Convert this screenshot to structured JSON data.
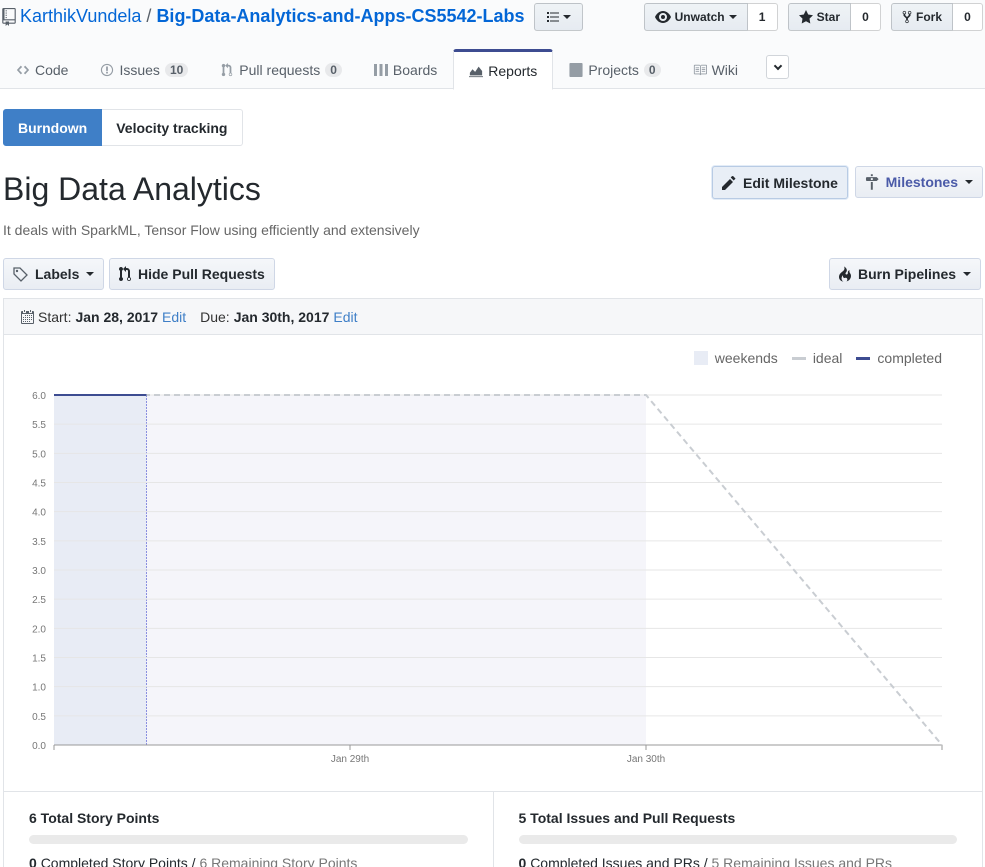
{
  "repo": {
    "owner": "KarthikVundela",
    "separator": "/",
    "name": "Big-Data-Analytics-and-Apps-CS5542-Labs"
  },
  "actions": {
    "watch_label": "Unwatch",
    "watch_count": "1",
    "star_label": "Star",
    "star_count": "0",
    "fork_label": "Fork",
    "fork_count": "0"
  },
  "nav": {
    "code": "Code",
    "issues": "Issues",
    "issues_count": "10",
    "pulls": "Pull requests",
    "pulls_count": "0",
    "boards": "Boards",
    "reports": "Reports",
    "projects": "Projects",
    "projects_count": "0",
    "wiki": "Wiki"
  },
  "subnav": {
    "burndown": "Burndown",
    "velocity": "Velocity tracking"
  },
  "milestone": {
    "title": "Big Data Analytics",
    "description": "It deals with SparkML, Tensor Flow using efficiently and extensively",
    "edit_label": "Edit Milestone",
    "milestones_label": "Milestones"
  },
  "toolbar": {
    "labels": "Labels",
    "hide_pr": "Hide Pull Requests",
    "burn_pipelines": "Burn Pipelines"
  },
  "dates": {
    "start_label": "Start:",
    "start_value": "Jan 28, 2017",
    "start_edit": "Edit",
    "due_label": "Due:",
    "due_value": "Jan 30th, 2017",
    "due_edit": "Edit"
  },
  "legend": {
    "weekends": "weekends",
    "ideal": "ideal",
    "completed": "completed"
  },
  "chart_data": {
    "type": "line",
    "ylim": [
      0,
      6
    ],
    "y_ticks": [
      "0.0",
      "0.5",
      "1.0",
      "1.5",
      "2.0",
      "2.5",
      "3.0",
      "3.5",
      "4.0",
      "4.5",
      "5.0",
      "5.5",
      "6.0"
    ],
    "x_domain": [
      "2017-01-28T00:00",
      "2017-01-31T00:00"
    ],
    "x_ticks": [
      {
        "label": "Jan 29th",
        "date": "2017-01-29T00:00"
      },
      {
        "label": "Jan 30th",
        "date": "2017-01-30T00:00"
      }
    ],
    "weekends": [
      {
        "start": "2017-01-28T00:00",
        "end": "2017-01-28T07:30"
      }
    ],
    "ideal": {
      "points": [
        [
          "2017-01-28T00:00",
          6
        ],
        [
          "2017-01-30T00:00",
          6
        ],
        [
          "2017-01-31T00:00",
          0
        ]
      ]
    },
    "series": [
      {
        "name": "completed",
        "points": [
          [
            "2017-01-28T00:00",
            6
          ],
          [
            "2017-01-28T07:30",
            6
          ]
        ]
      }
    ],
    "colors": {
      "completed": "#3d4c91",
      "ideal": "#c9cdd2",
      "weekend": "#e8ecf5",
      "period": "#f5f5fa"
    }
  },
  "stats": {
    "story_points_title": "6 Total Story Points",
    "story_completed_num": "0",
    "story_completed_label": "Completed Story Points",
    "story_remaining": "6 Remaining Story Points",
    "story_progress": 0,
    "issues_title": "5 Total Issues and Pull Requests",
    "issues_completed_num": "0",
    "issues_completed_label": "Completed Issues and PRs",
    "issues_remaining": "5 Remaining Issues and PRs",
    "issues_progress": 0
  }
}
